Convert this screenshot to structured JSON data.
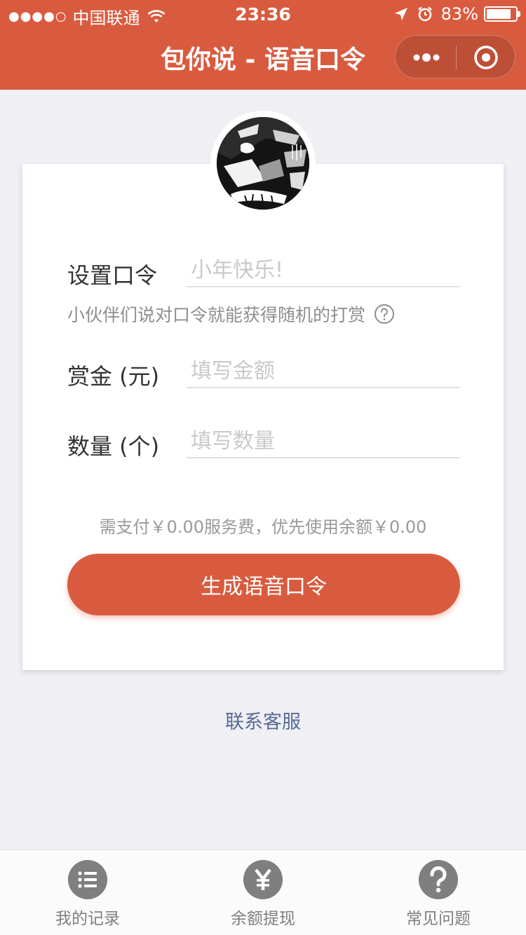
{
  "status_bar": {
    "signal": "●●●●○",
    "carrier": "中国联通",
    "time": "23:36",
    "battery": "83%"
  },
  "nav": {
    "title": "包你说 - 语音口令"
  },
  "form": {
    "password_label": "设置口令",
    "password_placeholder": "小年快乐!",
    "hint": "小伙伴们说对口令就能获得随机的打赏",
    "amount_label": "赏金 (元)",
    "amount_placeholder": "填写金额",
    "quantity_label": "数量 (个)",
    "quantity_placeholder": "填写数量",
    "payment_note": "需支付￥0.00服务费，优先使用余额￥0.00",
    "submit_label": "生成语音口令"
  },
  "contact_label": "联系客服",
  "tabs": [
    {
      "label": "我的记录",
      "icon": "list-icon"
    },
    {
      "label": "余额提现",
      "icon": "yuan-icon"
    },
    {
      "label": "常见问题",
      "icon": "question-icon"
    }
  ],
  "colors": {
    "brand": "#d95b3f",
    "background": "#efeff4",
    "link": "#576b95",
    "tab_icon": "#7f7f7f"
  }
}
